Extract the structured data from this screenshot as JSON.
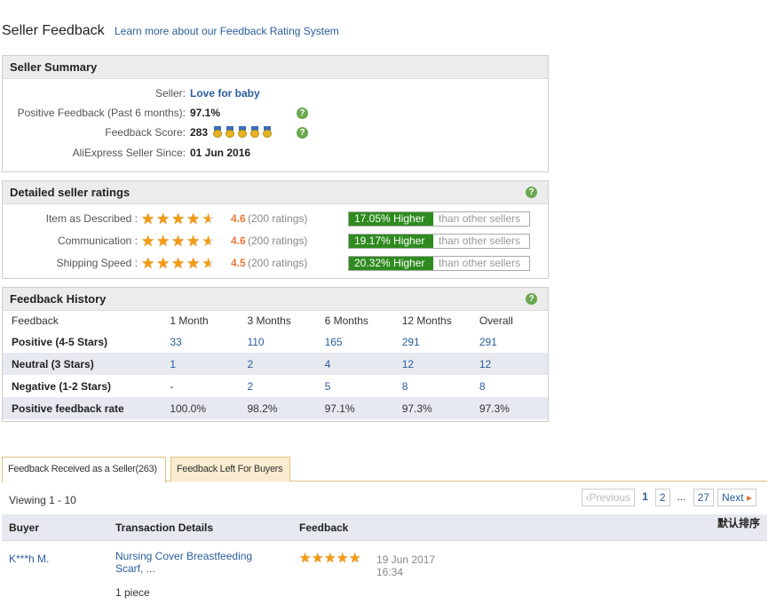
{
  "header": {
    "title": "Seller Feedback",
    "learn_link": "Learn more about our Feedback Rating System"
  },
  "summary": {
    "title": "Seller Summary",
    "seller_label": "Seller:",
    "seller_name": "Love for baby",
    "positive_label": "Positive Feedback (Past 6 months):",
    "positive_value": "97.1%",
    "score_label": "Feedback Score:",
    "score_value": "283",
    "score_medals": 5,
    "since_label": "AliExpress Seller Since:",
    "since_value": "01 Jun 2016"
  },
  "ratings": {
    "title": "Detailed seller ratings",
    "rows": [
      {
        "label": "Item as Described :",
        "stars": 4.6,
        "score": "4.6",
        "count": "(200 ratings)",
        "pct": "17.05% Higher",
        "cmp": "than other sellers"
      },
      {
        "label": "Communication :",
        "stars": 4.6,
        "score": "4.6",
        "count": "(200 ratings)",
        "pct": "19.17% Higher",
        "cmp": "than other sellers"
      },
      {
        "label": "Shipping Speed :",
        "stars": 4.5,
        "score": "4.5",
        "count": "(200 ratings)",
        "pct": "20.32% Higher",
        "cmp": "than other sellers"
      }
    ]
  },
  "history": {
    "title": "Feedback History",
    "columns": [
      "Feedback",
      "1 Month",
      "3 Months",
      "6 Months",
      "12 Months",
      "Overall"
    ],
    "rows": [
      {
        "label": "Positive (4-5 Stars)",
        "values": [
          "33",
          "110",
          "165",
          "291",
          "291"
        ]
      },
      {
        "label": "Neutral (3 Stars)",
        "values": [
          "1",
          "2",
          "4",
          "12",
          "12"
        ]
      },
      {
        "label": "Negative (1-2 Stars)",
        "values": [
          "-",
          "2",
          "5",
          "8",
          "8"
        ]
      },
      {
        "label": "Positive feedback rate",
        "values": [
          "100.0%",
          "98.2%",
          "97.1%",
          "97.3%",
          "97.3%"
        ]
      }
    ]
  },
  "tabs": [
    {
      "label": "Feedback Received as a Seller(263)",
      "active": true
    },
    {
      "label": "Feedback Left For Buyers",
      "active": false
    }
  ],
  "list": {
    "viewing": "Viewing 1 - 10",
    "sort_label": "默认排序",
    "pager": {
      "prev": "Previous",
      "page1": "1",
      "page2": "2",
      "dots": "...",
      "last": "27",
      "next": "Next"
    },
    "columns": {
      "buyer": "Buyer",
      "transaction": "Transaction Details",
      "feedback": "Feedback"
    },
    "items": [
      {
        "buyer": "K***h M.",
        "product": "Nursing Cover Breastfeeding Scarf, ...",
        "quantity": "1 piece",
        "stars": 5,
        "date": "19 Jun 2017",
        "time": "16:34"
      }
    ]
  },
  "colors": {
    "accent": "#2a5d9c",
    "higher_badge": "#2e8b1e",
    "star": "#f39c12",
    "score": "#e8793a"
  }
}
